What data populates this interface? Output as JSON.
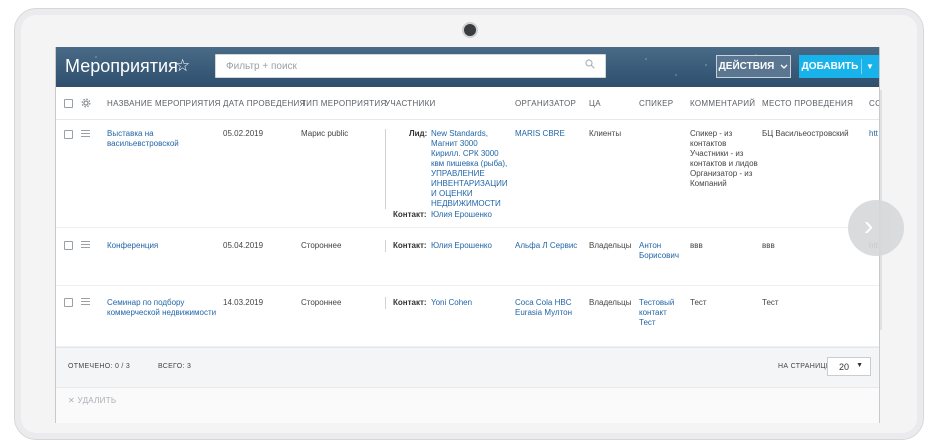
{
  "header": {
    "title": "Мероприятия",
    "search_placeholder": "Фильтр + поиск",
    "actions_label": "ДЕЙСТВИЯ",
    "add_label": "ДОБАВИТЬ"
  },
  "columns": [
    "НАЗВАНИЕ МЕРОПРИЯТИЯ",
    "ДАТА ПРОВЕДЕНИЯ",
    "ТИП МЕРОПРИЯТИЯ",
    "УЧАСТНИКИ",
    "ОРГАНИЗАТОР",
    "ЦА",
    "СПИКЕР",
    "КОММЕНТАРИЙ",
    "МЕСТО ПРОВЕДЕНИЯ",
    "СС"
  ],
  "rows": [
    {
      "name": [
        "Выставка на",
        "васильевстровской"
      ],
      "date": "05.02.2019",
      "type": "Марис public",
      "lead_label": "Лид:",
      "lead": [
        "New Standards,",
        "Магнит 3000",
        "Кирилл. СРК 3000",
        "квм пишевка (рыба),",
        "УПРАВЛЕНИЕ",
        "ИНВЕНТАРИЗАЦИИ",
        "И ОЦЕНКИ",
        "НЕДВИЖИМОСТИ"
      ],
      "contact_label": "Контакт:",
      "contact": "Юлия Ерошенко",
      "organizer": "MARIS CBRE",
      "audience": "Клиенты",
      "speaker": [],
      "comment": [
        "Спикер - из",
        "контактов",
        "Участники - из",
        "контактов и лидов",
        "Организатор - из",
        "Компаний"
      ],
      "place": "БЦ Васильеостровский",
      "extra": "htt"
    },
    {
      "name": [
        "Конференция"
      ],
      "date": "05.04.2019",
      "type": "Стороннее",
      "contact_label": "Контакт:",
      "contact": "Юлия Ерошенко",
      "organizer": [
        "Альфа Л Сервис"
      ],
      "audience": "Владельцы",
      "speaker": [
        "Антон",
        "Борисович"
      ],
      "comment": [
        "ввв"
      ],
      "place": "ввв",
      "extra": "htt"
    },
    {
      "name": [
        "Семинар по подбору",
        "коммерческой недвижимости"
      ],
      "date": "14.03.2019",
      "type": "Стороннее",
      "contact_label": "Контакт:",
      "contact": "Yoni Cohen",
      "organizer": [
        "Coca Cola HBC",
        "Eurasia Мултон"
      ],
      "audience": "Владельцы",
      "speaker": [
        "Тестовый",
        "контакт",
        "Тест"
      ],
      "comment": [
        "Тест"
      ],
      "place": "Тест",
      "extra": ""
    }
  ],
  "footer": {
    "selected": "ОТМЕЧЕНО: 0 / 3",
    "total": "ВСЕГО: 3",
    "per_page_label": "НА СТРАНИЦЕ:",
    "per_page_value": "20"
  },
  "delete_label": "УДАЛИТЬ"
}
